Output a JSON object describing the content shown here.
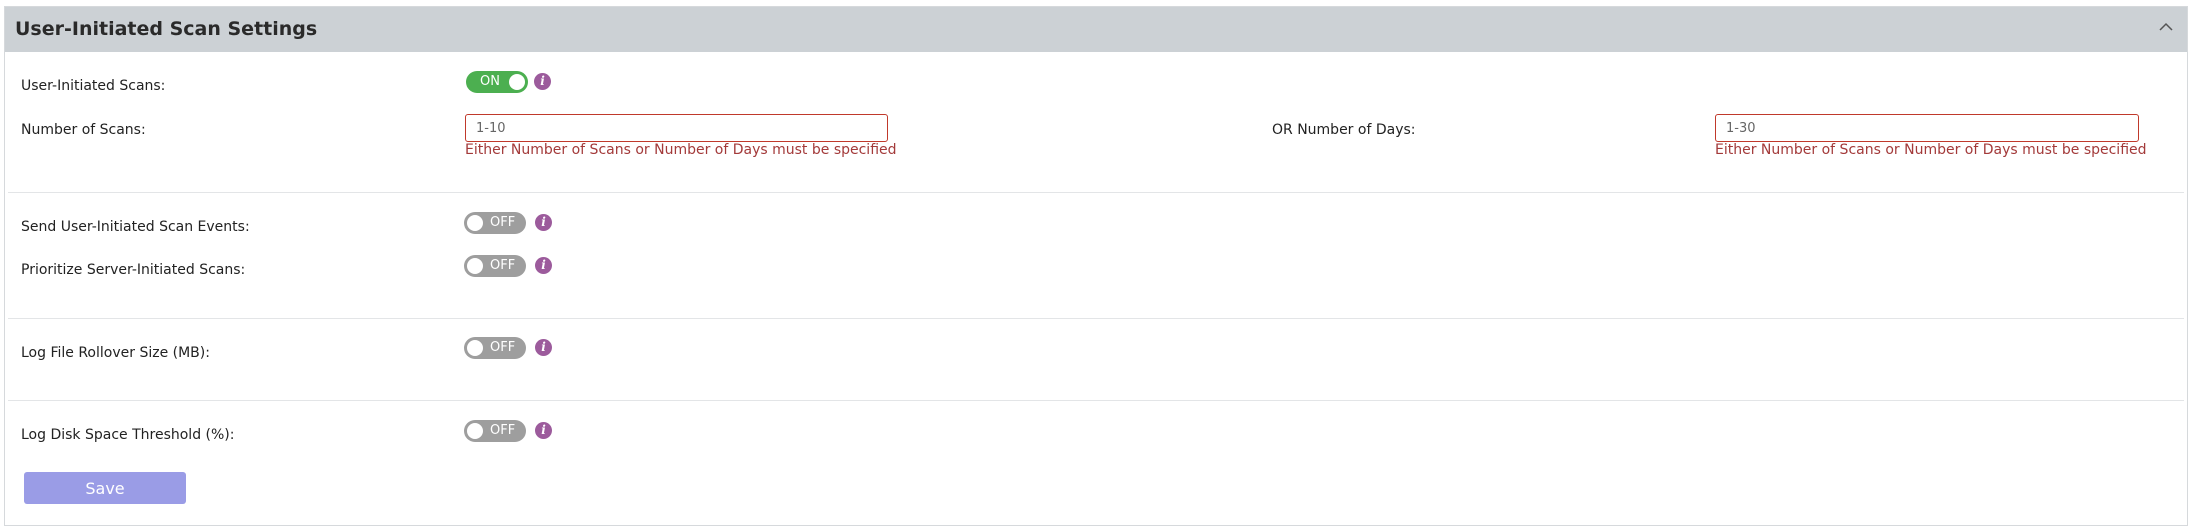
{
  "panel": {
    "title": "User-Initiated Scan Settings"
  },
  "settings": {
    "user_initiated_scans": {
      "label": "User-Initiated Scans:",
      "state": "ON"
    },
    "number_of_scans": {
      "label": "Number of Scans:",
      "placeholder": "1-10",
      "error": "Either Number of Scans or Number of Days must be specified"
    },
    "number_of_days": {
      "label": "OR Number of Days:",
      "placeholder": "1-30",
      "error": "Either Number of Scans or Number of Days must be specified"
    },
    "send_events": {
      "label": "Send User-Initiated Scan Events:",
      "state": "OFF"
    },
    "prioritize_server": {
      "label": "Prioritize Server-Initiated Scans:",
      "state": "OFF"
    },
    "log_rollover": {
      "label": "Log File Rollover Size (MB):",
      "state": "OFF"
    },
    "log_disk_threshold": {
      "label": "Log Disk Space Threshold (%):",
      "state": "OFF"
    }
  },
  "info_glyph": "i",
  "save_label": "Save",
  "colors": {
    "toggle_on": "#4caf50",
    "toggle_off": "#9e9e9e",
    "info": "#9c5b9c",
    "error": "#a33a3a",
    "save": "#9a9ce6"
  }
}
